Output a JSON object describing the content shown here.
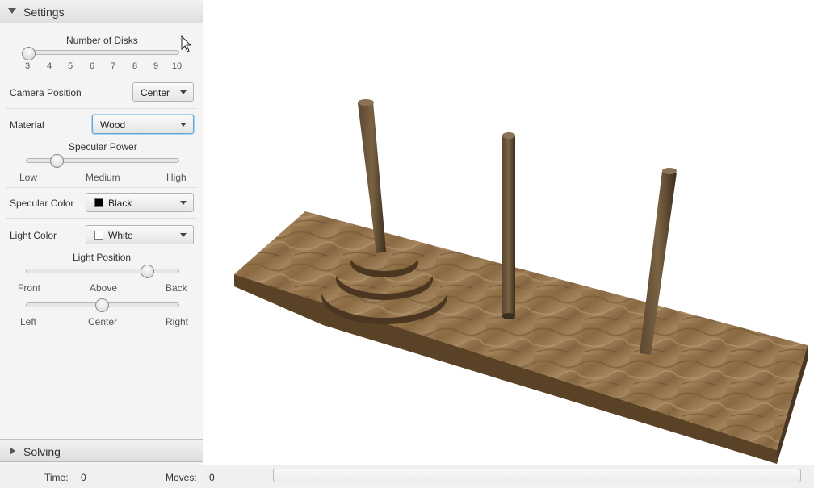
{
  "settings": {
    "title": "Settings",
    "disks": {
      "label": "Number of Disks",
      "ticks": [
        "3",
        "4",
        "5",
        "6",
        "7",
        "8",
        "9",
        "10"
      ],
      "value": 3
    },
    "camera": {
      "label": "Camera Position",
      "value": "Center"
    },
    "material": {
      "label": "Material",
      "value": "Wood"
    },
    "specular_power": {
      "label": "Specular Power",
      "ticks": [
        "Low",
        "Medium",
        "High"
      ],
      "level": 0.2
    },
    "specular_color": {
      "label": "Specular Color",
      "value": "Black",
      "swatch": "#000000"
    },
    "light_color": {
      "label": "Light Color",
      "value": "White",
      "swatch": "#ffffff"
    },
    "light_position": {
      "label": "Light Position",
      "depth_ticks": [
        "Front",
        "Above",
        "Back"
      ],
      "depth_level": 0.8,
      "side_ticks": [
        "Left",
        "Center",
        "Right"
      ],
      "side_level": 0.5
    }
  },
  "solving": {
    "title": "Solving"
  },
  "status": {
    "time_label": "Time:",
    "time_value": "0",
    "moves_label": "Moves:",
    "moves_value": "0",
    "progress": 0
  },
  "scene": {
    "description_icon": "tower-of-hanoi-3d",
    "board_color": "#8a6a43",
    "peg_color": "#4a3a26"
  }
}
